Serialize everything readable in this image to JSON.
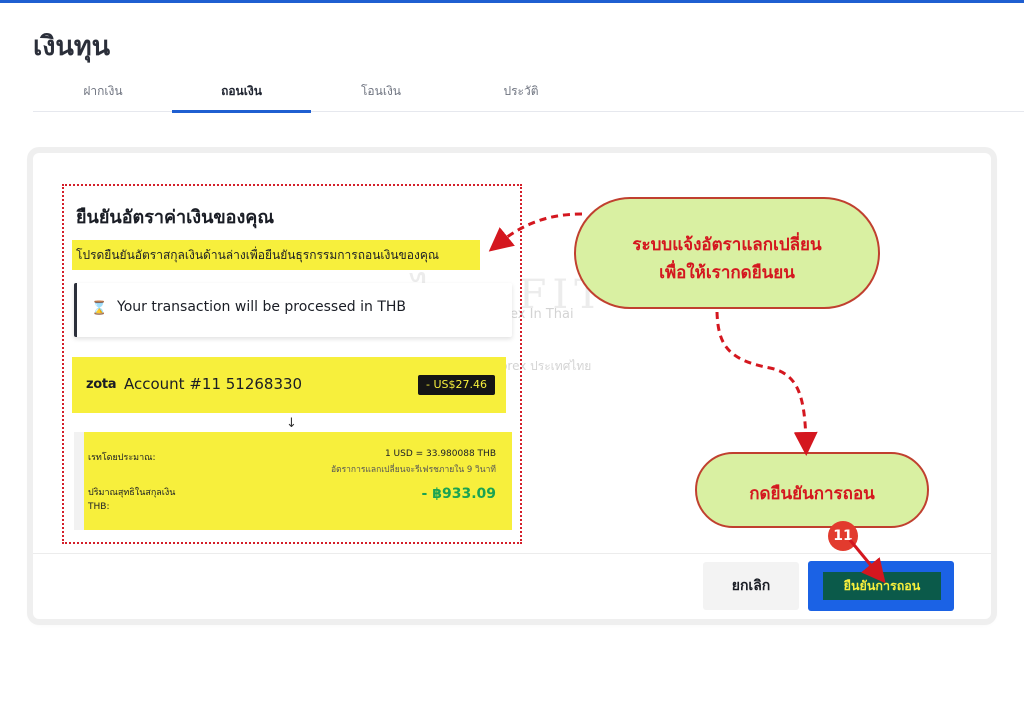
{
  "header": {
    "title": "เงินทุน"
  },
  "tabs": [
    {
      "label": "ฝากเงิน"
    },
    {
      "label": "ถอนเงิน"
    },
    {
      "label": "โอนเงิน"
    },
    {
      "label": "ประวัติ"
    }
  ],
  "confirm": {
    "title": "ยืนยันอัตราค่าเงินของคุณ",
    "instruction": "โปรดยืนยันอัตราสกุลเงินด้านล่างเพื่อยืนยันธุรกรรมการถอนเงินของคุณ",
    "notice": "Your transaction will be processed in THB",
    "account": {
      "brand": "zota",
      "label": "Account #11 51268330",
      "amount": "- US$27.46"
    },
    "rate_label": "เรทโดยประมาณ:",
    "rate_value": "1 USD = 33.980088 THB",
    "rate_note": "อัตราการแลกเปลี่ยนจะรีเฟรชภายใน 9 วินาที",
    "net_label": "ปริมาณสุทธิในสกุลเงิน THB:",
    "net_value": "- ฿933.09"
  },
  "watermark": {
    "logo": "ไทย FIT",
    "line1": "Forex In Thai",
    "line2": "แหล่งเรียนรู้การเทรด Forex ประเทศไทย"
  },
  "annotations": {
    "bubble1_line1": "ระบบแจ้งอัตราแลกเปลี่ยน",
    "bubble1_line2": "เพื่อให้เรากดยืนยน",
    "bubble2": "กดยืนยันการถอน",
    "step": "11"
  },
  "buttons": {
    "cancel": "ยกเลิก",
    "confirm": "ยืนยันการถอน"
  },
  "colors": {
    "accent": "#1b62e5",
    "highlight": "#f7ef3c",
    "annotation_red": "#d4171f",
    "bubble_fill": "#d9f0a2",
    "net_green": "#1aa352"
  }
}
